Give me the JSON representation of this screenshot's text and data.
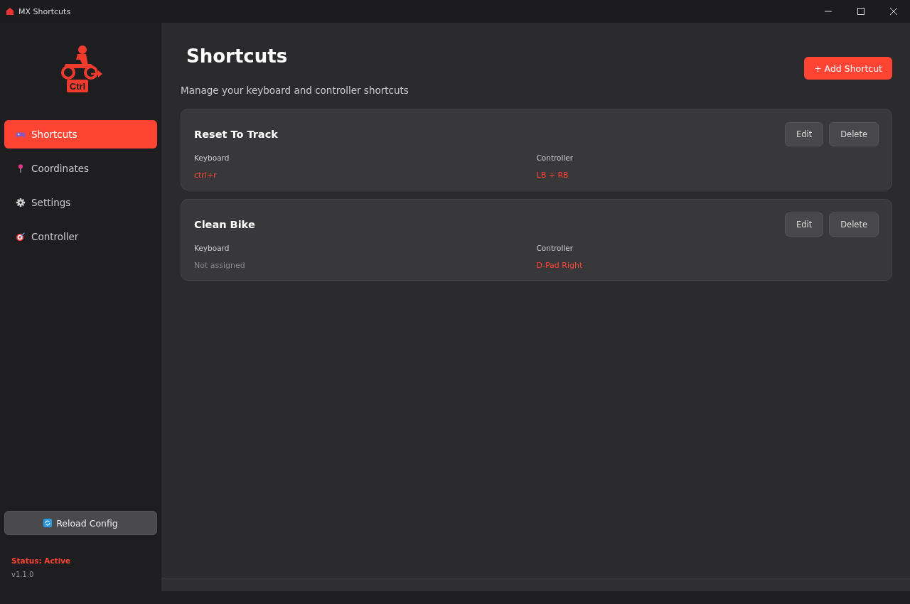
{
  "window": {
    "title": "MX Shortcuts"
  },
  "sidebar": {
    "logo_text": "Ctrl",
    "items": [
      {
        "label": "Shortcuts",
        "kind": "gamepad",
        "selected": true
      },
      {
        "label": "Coordinates",
        "kind": "pin",
        "selected": false
      },
      {
        "label": "Settings",
        "kind": "gear",
        "selected": false
      },
      {
        "label": "Controller",
        "kind": "target",
        "selected": false
      }
    ],
    "reload_button": "Reload Config",
    "status": "Status: Active",
    "version": "v1.1.0"
  },
  "main": {
    "title": "Shortcuts",
    "subtitle": "Manage your keyboard and controller shortcuts",
    "add_button": "+ Add Shortcut",
    "shortcuts": [
      {
        "name": "Reset To Track",
        "keyboard_label": "Keyboard",
        "keyboard": "ctrl+r",
        "keyboard_assigned": true,
        "controller_label": "Controller",
        "controller": "LB + RB",
        "controller_assigned": true,
        "edit": "Edit",
        "delete": "Delete"
      },
      {
        "name": "Clean Bike",
        "keyboard_label": "Keyboard",
        "keyboard": "Not assigned",
        "keyboard_assigned": false,
        "controller_label": "Controller",
        "controller": "D-Pad Right",
        "controller_assigned": true,
        "edit": "Edit",
        "delete": "Delete"
      }
    ]
  }
}
